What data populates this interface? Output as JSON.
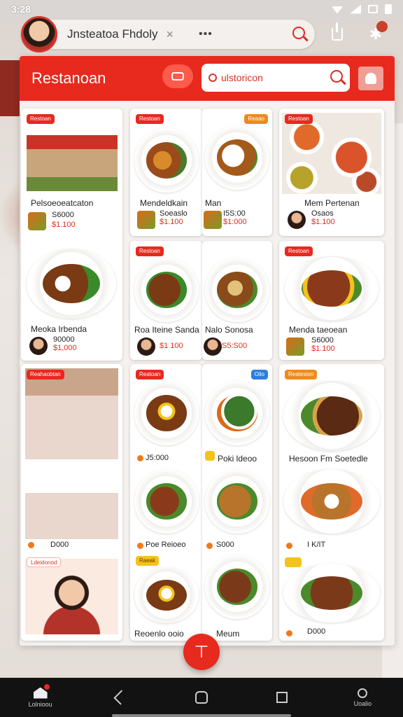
{
  "status": {
    "time": "3:28"
  },
  "topbar": {
    "title": "Jnsteatoa Fhdoly",
    "close_icon": "×",
    "more": "•••"
  },
  "panel": {
    "title": "Restanoan",
    "search_value": "ulstoricon"
  },
  "cards": {
    "c1": {
      "badge": "Restoan",
      "name": "Pelsoeoeatcaton",
      "price_a": "S6000",
      "price_b": "$1.100"
    },
    "c2": {
      "badge": "Restoan",
      "name": "Mendeldkain",
      "price_a": "Soeaslo",
      "price_b": "$1.100"
    },
    "c3": {
      "badge": "Reaao",
      "name": "Man",
      "price_a": "I5S:00",
      "price_b": "$1:000"
    },
    "c4": {
      "badge": "Restoan",
      "name": "Mem Pertenan",
      "price_a": "Osaos",
      "price_b": "$1.100"
    },
    "c5": {
      "name": "Meoka Irbenda",
      "price_a": "90000",
      "price_b": "$1,000"
    },
    "c6": {
      "badge": "Restoan",
      "name": "Roa Iteine Sanda",
      "price_b": "$1 100"
    },
    "c7": {
      "name": "Nalo Sonosa",
      "price_b": "S5:S00"
    },
    "c8": {
      "name": "Menda taeoean",
      "price_a": "S6000",
      "price_b": "$1.100"
    },
    "c9": {
      "badge": "Reahaobtan",
      "price": "D000",
      "badge2": "Ldeidonod"
    },
    "c10": {
      "badge": "Reatoan",
      "price": "J5:000",
      "price2": "Poe Reioeo",
      "badge2": "Raeak",
      "name": "Reoenlo ooio"
    },
    "c11": {
      "badge": "Oilo",
      "name": "Poki ldeoo",
      "price": "S000",
      "name2": "Meum"
    },
    "c12": {
      "badge": "Reatesion",
      "name": "Hesoon Fm Soetedle",
      "price": "I K/IT",
      "price2": "D000"
    }
  },
  "nav": {
    "home_label": "Lolnioou",
    "settings_label": "Uoalio"
  },
  "colors": {
    "accent": "#e8291e",
    "badge_orange": "#f08a1a",
    "badge_blue": "#2a7fe0",
    "badge_yellow": "#f4c21a"
  }
}
